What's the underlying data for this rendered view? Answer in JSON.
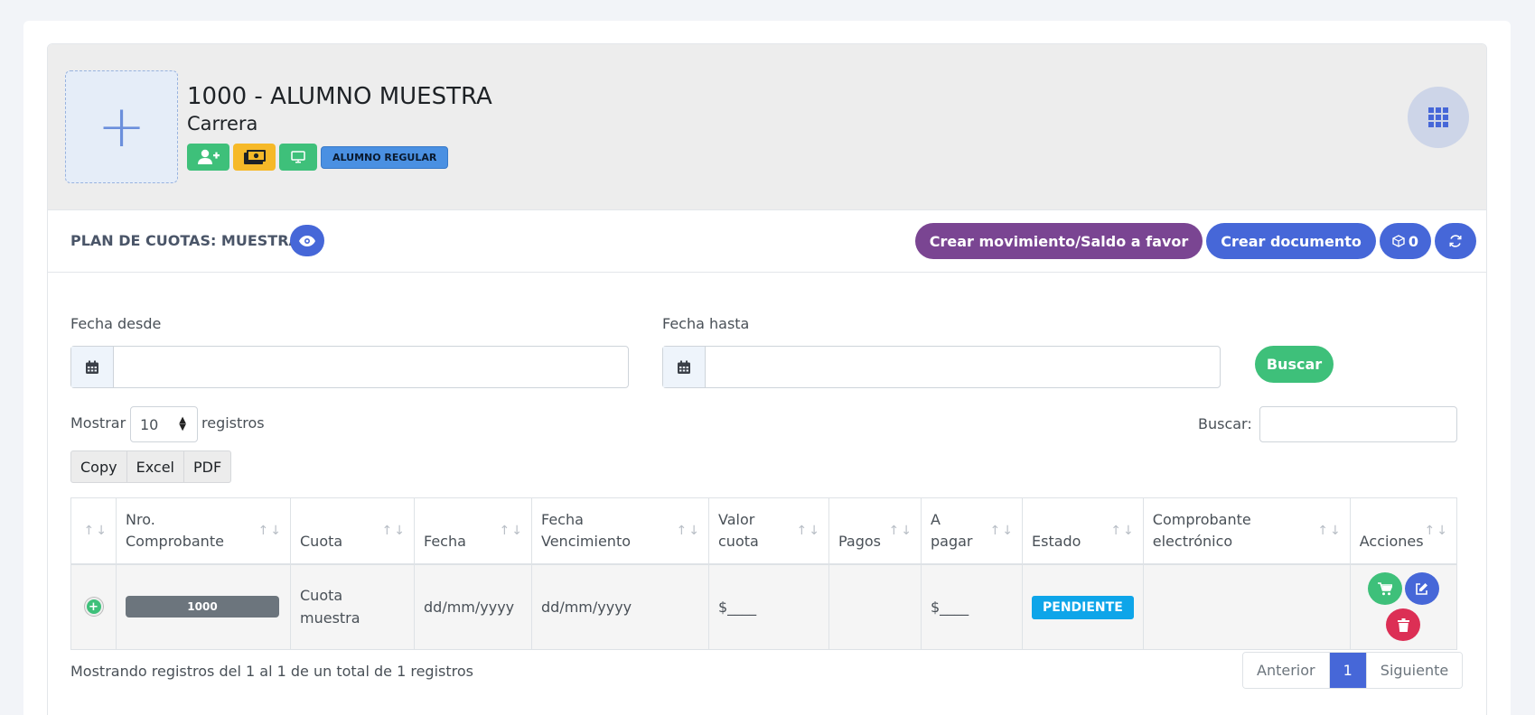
{
  "student": {
    "name": "1000 - ALUMNO MUESTRA",
    "career": "Carrera",
    "status_badge": "ALUMNO REGULAR",
    "avatar_glyph": "+"
  },
  "toolbar": {
    "plan_title": "PLAN DE CUOTAS: MUESTRA",
    "create_movement_label": "Crear movimiento/Saldo a favor",
    "create_document_label": "Crear documento",
    "box_count": "0"
  },
  "filters": {
    "date_from_label": "Fecha desde",
    "date_to_label": "Fecha hasta",
    "search_button": "Buscar"
  },
  "datatable": {
    "show_label": "Mostrar",
    "page_size": "10",
    "records_label": "registros",
    "search_label": "Buscar:",
    "export_buttons": [
      "Copy",
      "Excel",
      "PDF"
    ],
    "columns": [
      "",
      "Nro. Comprobante",
      "Cuota",
      "Fecha",
      "Fecha Vencimiento",
      "Valor cuota",
      "Pagos",
      "A pagar",
      "Estado",
      "Comprobante electrónico",
      "Acciones"
    ],
    "rows": [
      {
        "nro": "1000",
        "cuota": "Cuota muestra",
        "fecha": "dd/mm/yyyy",
        "vencimiento": "dd/mm/yyyy",
        "valor": "$____",
        "pagos": "",
        "a_pagar": "$____",
        "estado": "PENDIENTE",
        "comprobante": ""
      }
    ],
    "info": "Mostrando registros del 1 al 1 de un total de 1 registros",
    "pager": {
      "prev": "Anterior",
      "current": "1",
      "next": "Siguiente"
    }
  },
  "icons": {
    "add-user": "user-plus-icon",
    "money": "money-bill-icon",
    "monitor": "desktop-icon",
    "apps": "grid-icon",
    "eye": "eye-icon",
    "box": "box-icon",
    "refresh": "refresh-icon",
    "calendar": "calendar-icon",
    "cart": "cart-icon",
    "edit": "edit-icon",
    "trash": "trash-icon",
    "expand": "plus-circle-icon"
  },
  "colors": {
    "primary": "#4667d8",
    "success": "#3ec07a",
    "warning": "#f6b928",
    "purple": "#7a4592",
    "danger": "#dc2f55",
    "info": "#0ea5e9"
  }
}
